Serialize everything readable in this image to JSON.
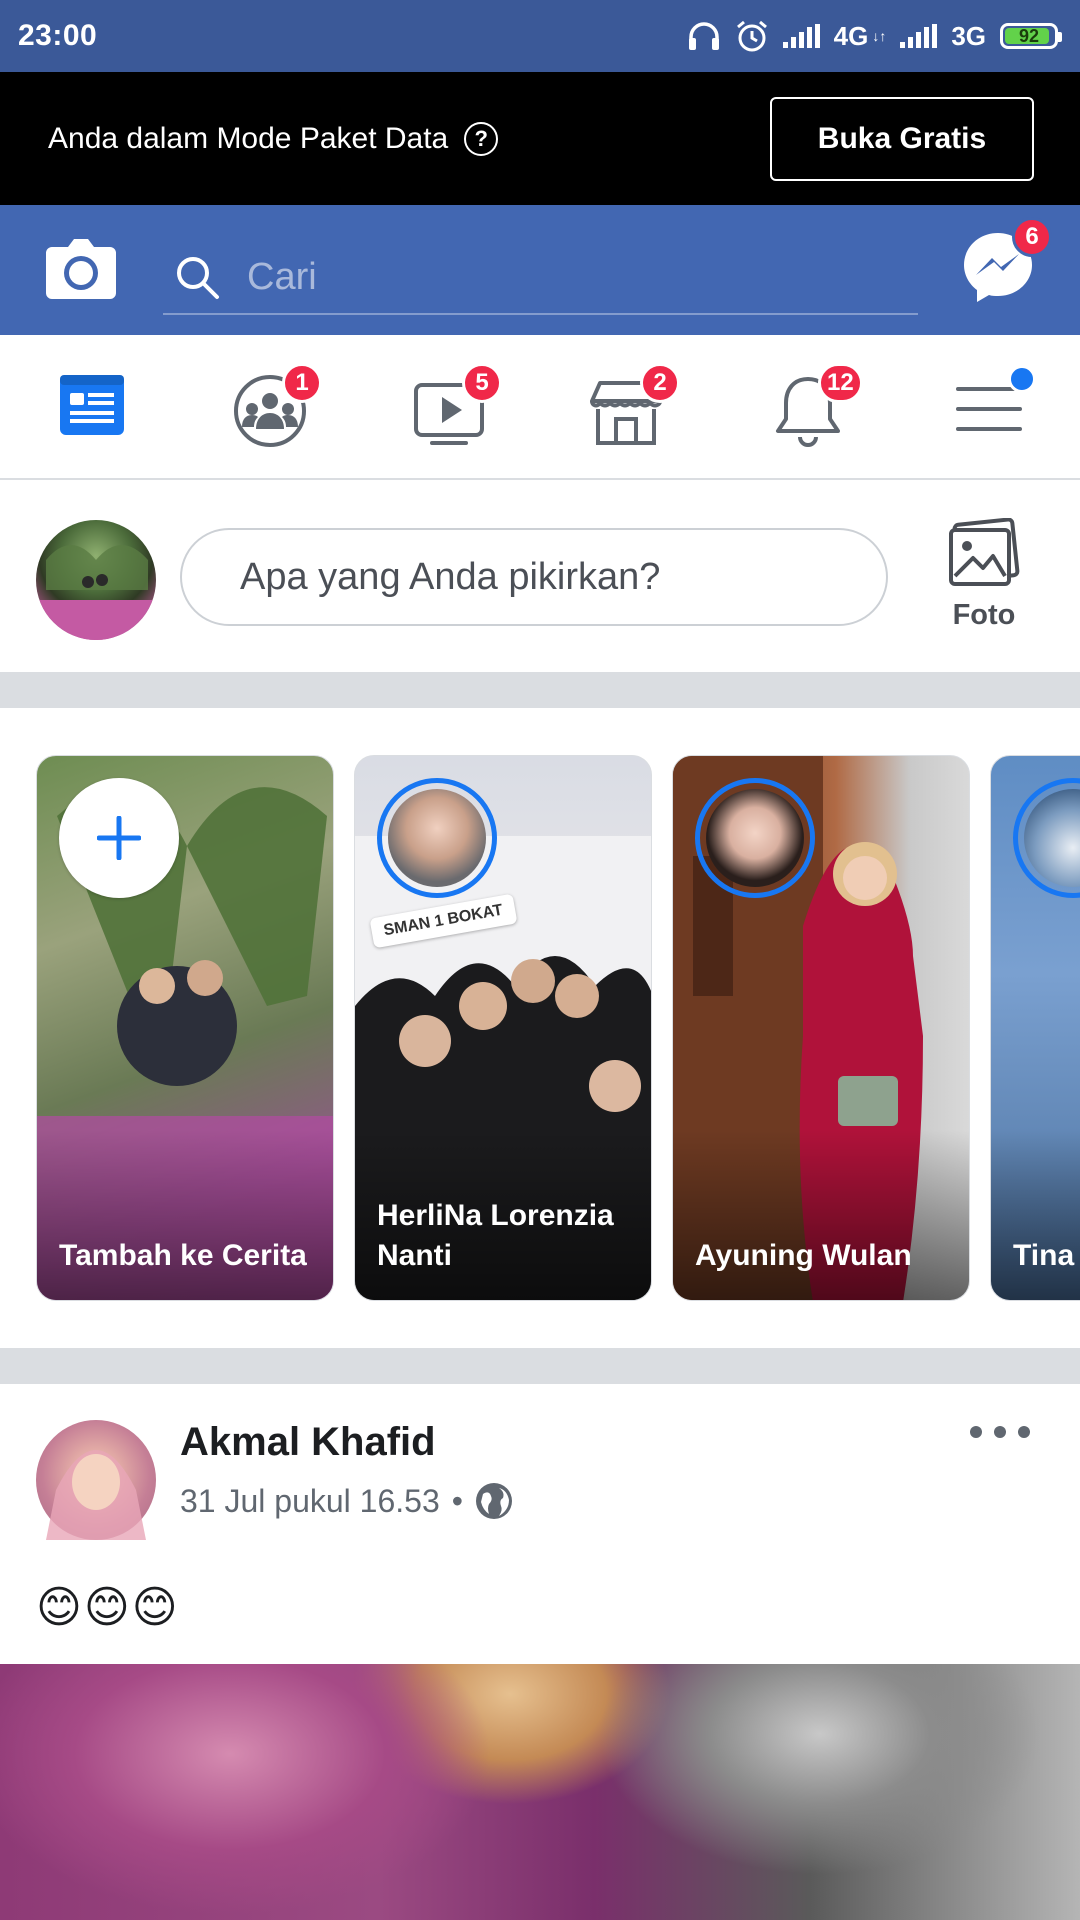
{
  "status_bar": {
    "time": "23:00",
    "network_1": "4G",
    "network_1_sub": "↓↑",
    "network_2": "3G",
    "battery": "92",
    "battery_level": 0.92,
    "icons": [
      "headphones-icon",
      "alarm-icon",
      "signal-icon",
      "signal-icon"
    ]
  },
  "data_banner": {
    "message": "Anda dalam Mode Paket Data",
    "help_glyph": "?",
    "button": "Buka Gratis"
  },
  "header": {
    "search_placeholder": "Cari",
    "messenger_badge": "6",
    "colors": {
      "header_blue": "#4267b2",
      "status_blue": "#3b5998",
      "badge_red": "#f02849"
    }
  },
  "tabs": [
    {
      "name": "news-feed",
      "icon": "news-feed-icon",
      "badge": ""
    },
    {
      "name": "groups",
      "icon": "groups-icon",
      "badge": "1"
    },
    {
      "name": "watch",
      "icon": "watch-icon",
      "badge": "5"
    },
    {
      "name": "marketplace",
      "icon": "marketplace-icon",
      "badge": "2"
    },
    {
      "name": "notifications",
      "icon": "bell-icon",
      "badge": "12"
    },
    {
      "name": "menu",
      "icon": "hamburger-menu-icon",
      "badge": ""
    }
  ],
  "composer": {
    "placeholder": "Apa yang Anda pikirkan?",
    "photo_label": "Foto"
  },
  "stories": [
    {
      "name": "Tambah ke Cerita"
    },
    {
      "name": "HerliNa Lorenzia Nanti",
      "tag": "SMAN 1 BOKAT"
    },
    {
      "name": "Ayuning Wulan"
    },
    {
      "name": "Tina"
    }
  ],
  "post": {
    "author": "Akmal Khafid",
    "time": "31 Jul pukul 16.53",
    "separator": "•",
    "text": "😊😊😊"
  }
}
